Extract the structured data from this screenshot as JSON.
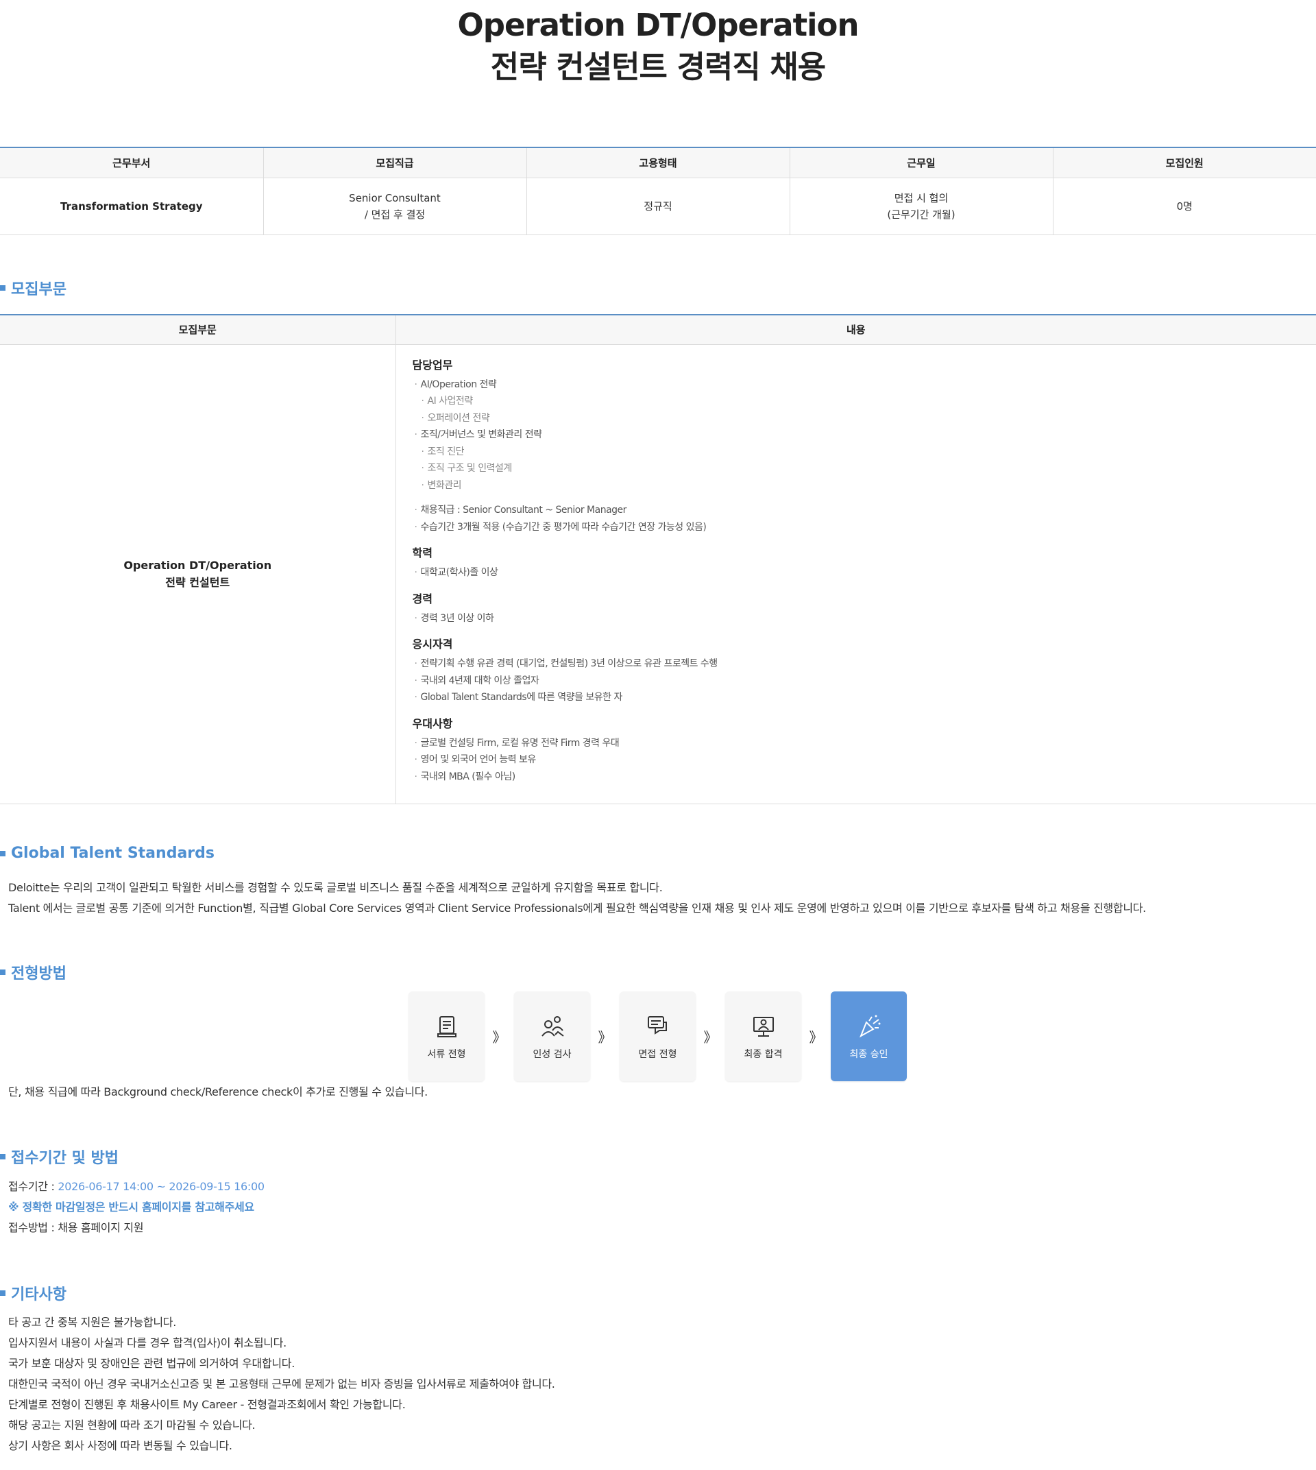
{
  "title": {
    "line1": "Operation DT/Operation",
    "line2": "전략 컨설턴트 경력직 채용"
  },
  "summary": {
    "headers": [
      "근무부서",
      "모집직급",
      "고용형태",
      "근무일",
      "모집인원"
    ],
    "dept": "Transformation Strategy",
    "rank_line1": "Senior Consultant",
    "rank_line2": "/ 면접 후 결정",
    "type": "정규직",
    "workday_line1": "면접 시 협의",
    "workday_line2": "(근무기간 개월)",
    "count": "0명"
  },
  "sections": {
    "recruit": "모집부문",
    "gts": "Global Talent Standards",
    "process": "전형방법",
    "apply": "접수기간 및 방법",
    "etc": "기타사항"
  },
  "recruit_table": {
    "header_col1": "모집부문",
    "header_col2": "내용",
    "name_line1": "Operation DT/Operation",
    "name_line2": "전략 컨설턴트",
    "duty_title": "담당업무",
    "duty_1": "AI/Operation 전략",
    "duty_1_1": "AI 사업전략",
    "duty_1_2": "오퍼레이션 전략",
    "duty_2": "조직/거버넌스 및 변화관리 전략",
    "duty_2_1": "조직 진단",
    "duty_2_2": "조직 구조 및 인력설계",
    "duty_2_3": "변화관리",
    "duty_3": "채용직급 : Senior Consultant ~ Senior Manager",
    "duty_4": "수습기간 3개월 적용 (수습기간 중 평가에 따라 수습기간 연장 가능성 있음)",
    "edu_title": "학력",
    "edu_1": "대학교(학사)졸 이상",
    "exp_title": "경력",
    "exp_1": "경력 3년 이상  이하",
    "qual_title": "응시자격",
    "qual_1": "전략기획 수행 유관 경력 (대기업, 컨설팅펌) 3년 이상으로 유관 프로젝트 수행",
    "qual_2": "국내외 4년제 대학 이상 졸업자",
    "qual_3": "Global Talent Standards에 따른 역량을 보유한 자",
    "pref_title": "우대사항",
    "pref_1": "글로벌 컨설팅 Firm, 로컬 유명 전략 Firm 경력 우대",
    "pref_2": "영어 및 외국어 언어 능력 보유",
    "pref_3": "국내외 MBA (필수 아님)"
  },
  "gts_text": {
    "line1": "Deloitte는 우리의 고객이 일관되고 탁월한 서비스를 경험할 수 있도록 글로벌 비즈니스 품질 수준을 세계적으로 균일하게 유지함을 목표로 합니다.",
    "line2": "Talent 에서는 글로벌 공통 기준에 의거한 Function별, 직급별 Global Core Services 영역과 Client Service Professionals에게 필요한 핵심역량을 인재 채용 및 인사 제도 운영에 반영하고 있으며 이를 기반으로 후보자를 탐색 하고 채용을 진행합니다."
  },
  "process": {
    "arrow": "》",
    "steps": [
      {
        "label": "서류 전형",
        "icon": "document-icon"
      },
      {
        "label": "인성 검사",
        "icon": "people-icon"
      },
      {
        "label": "면접 전형",
        "icon": "interview-icon"
      },
      {
        "label": "최종 합격",
        "icon": "monitor-person-icon"
      },
      {
        "label": "최종 승인",
        "icon": "party-popper-icon"
      }
    ],
    "note": "단, 채용 직급에 따라 Background check/Reference check이 추가로 진행될 수 있습니다."
  },
  "apply": {
    "period_label": "접수기간 : ",
    "period_value": "2026-06-17 14:00 ~ 2026-09-15 16:00",
    "notice": "※ 정확한 마감일정은 반드시 홈페이지를 참고해주세요",
    "method": "접수방법 : 채용 홈페이지 지원"
  },
  "etc": {
    "items": [
      "타 공고 간 중복 지원은 불가능합니다.",
      "입사지원서 내용이 사실과 다를 경우 합격(입사)이 취소됩니다.",
      "국가 보훈 대상자 및 장애인은 관련 법규에 의거하여 우대합니다.",
      "대한민국 국적이 아닌 경우 국내거소신고증 및 본 고용형태 근무에 문제가 없는 비자 증빙을 입사서류로 제출하여야 합니다.",
      "단계별로 전형이 진행된 후 채용사이트 My Career - 전형결과조회에서 확인 가능합니다.",
      "해당 공고는 지원 현황에 따라 조기 마감될 수 있습니다.",
      "상기 사항은 회사 사정에 따라 변동될 수 있습니다."
    ]
  },
  "colors": {
    "accent": "#4e8fd1",
    "active_step": "#5d96dc",
    "table_border": "#5a8ec4"
  }
}
